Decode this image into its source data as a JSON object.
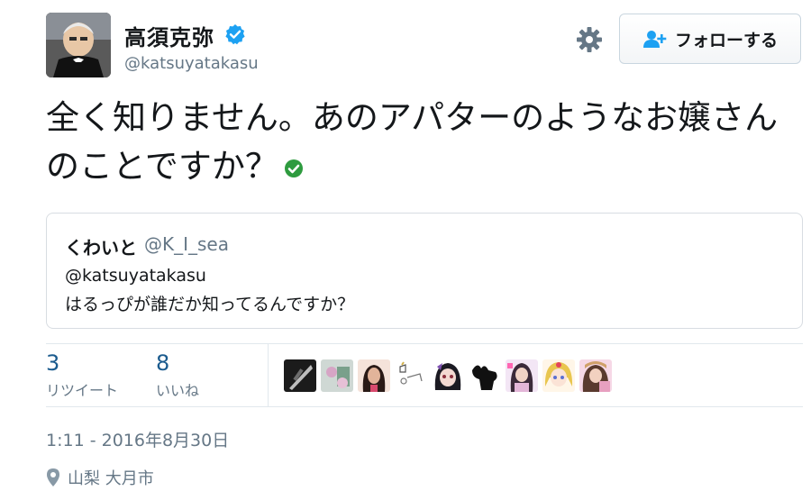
{
  "header": {
    "display_name": "高須克弥",
    "handle": "@katsuyatakasu",
    "follow_label": "フォローする",
    "verified_icon": "verified-badge-icon",
    "settings_icon": "gear-icon"
  },
  "tweet": {
    "text": "全く知りません。あのアパターのようなお嬢さんのことですか？",
    "emoji_icon": "green-check-icon"
  },
  "quote": {
    "name": "くわいと",
    "handle": "@K_I_sea",
    "line1": "@katsuyatakasu",
    "line2": "はるっぴが誰だか知ってるんですか？"
  },
  "stats": {
    "retweets_count": "3",
    "retweets_label": "リツイート",
    "likes_count": "8",
    "likes_label": "いいね"
  },
  "likers": [
    "liker-avatar-1",
    "liker-avatar-2",
    "liker-avatar-3",
    "liker-avatar-4",
    "liker-avatar-5",
    "liker-avatar-6",
    "liker-avatar-7",
    "liker-avatar-8",
    "liker-avatar-9"
  ],
  "meta": {
    "timestamp": "1:11 - 2016年8月30日",
    "location": "山梨 大月市",
    "location_icon": "map-pin-icon"
  },
  "colors": {
    "link_blue": "#1b5b8e",
    "muted_gray": "#657786",
    "verified_blue": "#1da1f2",
    "check_green": "#2e9b3f"
  }
}
